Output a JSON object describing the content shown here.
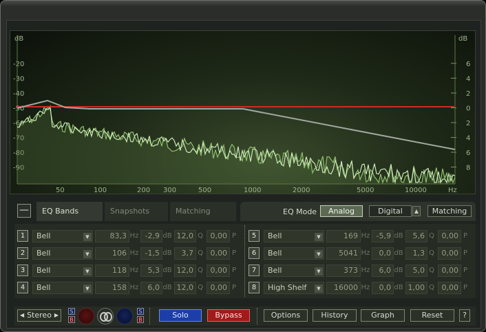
{
  "graph": {
    "left_axis_title": "dB",
    "right_axis_title": "dB",
    "left_ticks": [
      "-20",
      "-30",
      "-40",
      "-50",
      "-60",
      "-70",
      "-80",
      "-90"
    ],
    "right_ticks": [
      "6",
      "4",
      "2",
      "0",
      "2",
      "4",
      "6",
      "8"
    ],
    "freq_ticks": [
      "50",
      "100",
      "200",
      "300",
      "500",
      "1000",
      "2000",
      "5000",
      "10000",
      "Hz"
    ]
  },
  "tabs": {
    "collapse_symbol": "—",
    "eq_bands": "EQ Bands",
    "snapshots": "Snapshots",
    "matching": "Matching"
  },
  "eq_mode": {
    "label": "EQ Mode",
    "analog": "Analog",
    "digital": "Digital",
    "matching": "Matching",
    "active": "Analog"
  },
  "units": {
    "hz": "Hz",
    "db": "dB",
    "q": "Q",
    "p": "P"
  },
  "bands": [
    {
      "num": "1",
      "type": "Bell",
      "freq": "83,3",
      "gain": "-2,9",
      "q": "12,0",
      "p": "0,00"
    },
    {
      "num": "2",
      "type": "Bell",
      "freq": "106",
      "gain": "-1,5",
      "q": "3,7",
      "p": "0,00"
    },
    {
      "num": "3",
      "type": "Bell",
      "freq": "118",
      "gain": "5,3",
      "q": "12,0",
      "p": "0,00"
    },
    {
      "num": "4",
      "type": "Bell",
      "freq": "158",
      "gain": "6,0",
      "q": "12,0",
      "p": "0,00"
    },
    {
      "num": "5",
      "type": "Bell",
      "freq": "169",
      "gain": "-5,9",
      "q": "5,6",
      "p": "0,00"
    },
    {
      "num": "6",
      "type": "Bell",
      "freq": "5041",
      "gain": "0,0",
      "q": "1,3",
      "p": "0,00"
    },
    {
      "num": "7",
      "type": "Bell",
      "freq": "373",
      "gain": "6,0",
      "q": "5,0",
      "p": "0,00"
    },
    {
      "num": "8",
      "type": "High Shelf",
      "freq": "16000",
      "gain": "0,0",
      "q": "1,00",
      "p": "0,00"
    }
  ],
  "bottom": {
    "stereo": "Stereo",
    "s": "S",
    "b": "B",
    "solo": "Solo",
    "bypass": "Bypass",
    "options": "Options",
    "history": "History",
    "graph": "Graph",
    "reset": "Reset",
    "help": "?"
  },
  "colors": {
    "reference_line": "#d12a22",
    "eq_curve": "#a3a8a0",
    "spectrum_a": "#8fbf6e",
    "spectrum_b": "#cde8b8",
    "solo": "#1c3ea8",
    "bypass": "#a11a1a"
  }
}
